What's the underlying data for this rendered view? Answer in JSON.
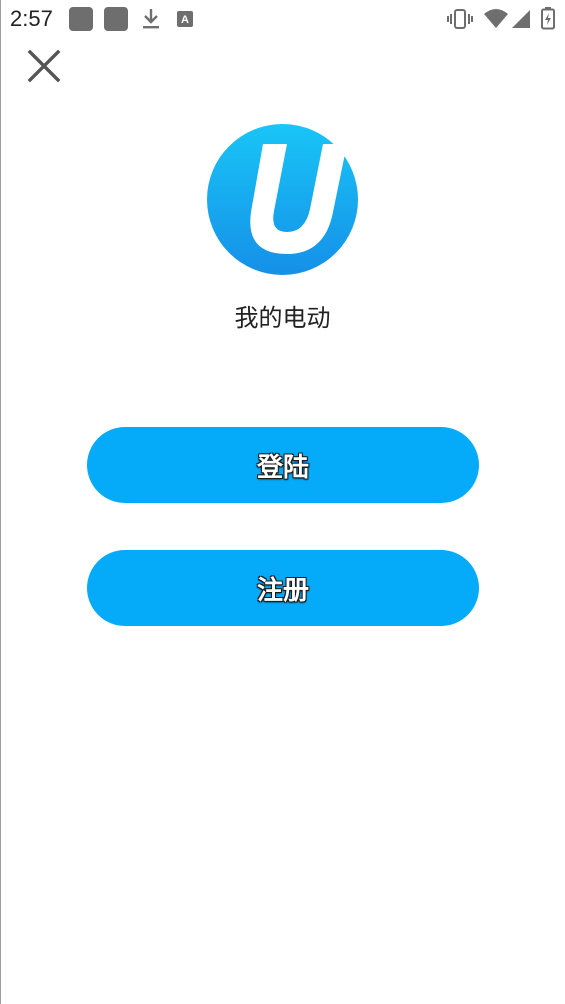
{
  "status_bar": {
    "time": "2:57",
    "icons": [
      "notification-square-icon",
      "notification-square-icon",
      "download-icon",
      "a-badge-icon",
      "vibrate-icon",
      "wifi-icon",
      "signal-icon",
      "battery-charging-icon"
    ]
  },
  "app": {
    "name": "我的电动",
    "logo_letter": "U"
  },
  "actions": {
    "login_label": "登陆",
    "register_label": "注册"
  },
  "colors": {
    "primary": "#05abf8",
    "logo_gradient_top": "#19c5f7",
    "logo_gradient_bottom": "#1590e8"
  }
}
